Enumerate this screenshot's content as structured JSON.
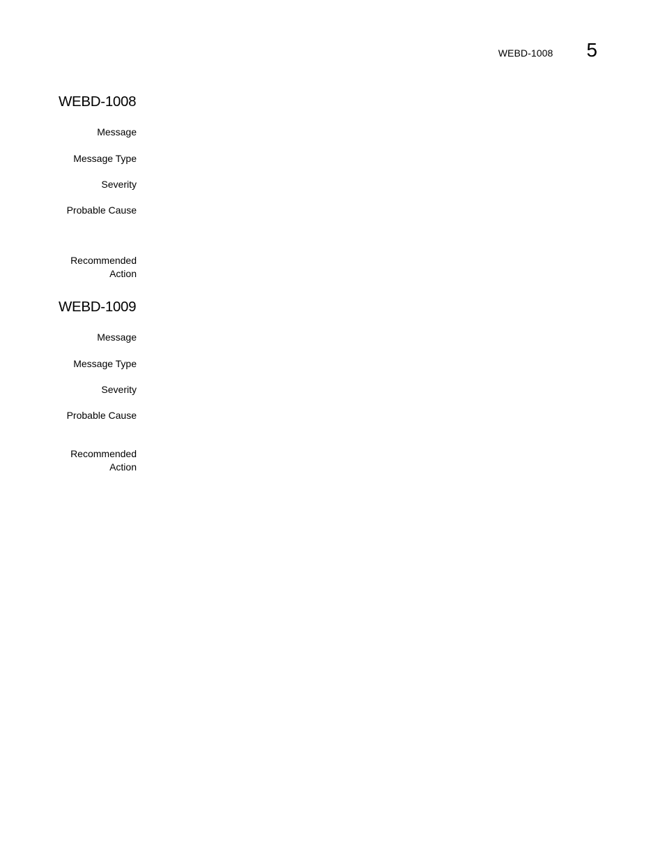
{
  "running_header": {
    "title": "WEBD-1008",
    "chapter_number": "5"
  },
  "entries": [
    {
      "id": "WEBD-1008",
      "fields": [
        {
          "label": "Message",
          "value": ""
        },
        {
          "label": "Message Type",
          "value": ""
        },
        {
          "label": "Severity",
          "value": ""
        },
        {
          "label": "Probable Cause",
          "value": ""
        },
        {
          "label_line1": "Recommended",
          "label_line2": "Action",
          "value": ""
        }
      ]
    },
    {
      "id": "WEBD-1009",
      "fields": [
        {
          "label": "Message",
          "value": ""
        },
        {
          "label": "Message Type",
          "value": ""
        },
        {
          "label": "Severity",
          "value": ""
        },
        {
          "label": "Probable Cause",
          "value": ""
        },
        {
          "label_line1": "Recommended",
          "label_line2": "Action",
          "value": ""
        }
      ]
    }
  ]
}
